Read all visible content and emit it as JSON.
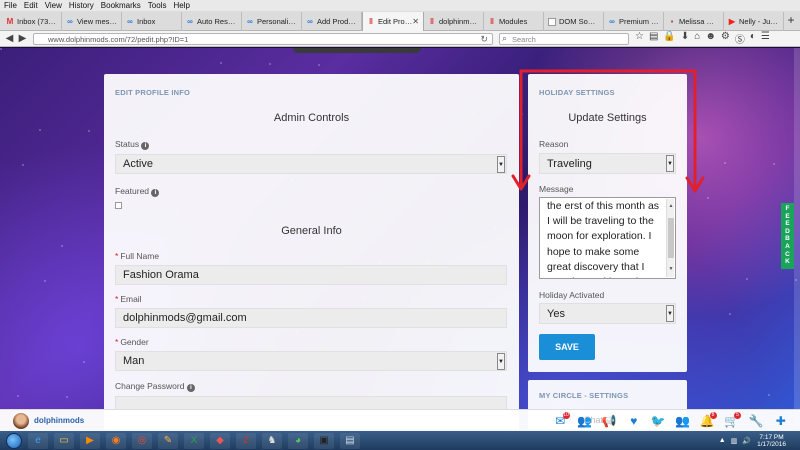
{
  "menubar": [
    "File",
    "Edit",
    "View",
    "History",
    "Bookmarks",
    "Tools",
    "Help"
  ],
  "tabs": [
    {
      "label": "Inbox (737) ...",
      "icon": "gmail-icon",
      "glyph": "M",
      "color": "#d33"
    },
    {
      "label": "View messa...",
      "icon": "link-icon",
      "glyph": "∞",
      "color": "#2f7fd4"
    },
    {
      "label": "Inbox",
      "icon": "link-icon",
      "glyph": "∞",
      "color": "#2f7fd4"
    },
    {
      "label": "Auto Respo...",
      "icon": "link-icon",
      "glyph": "∞",
      "color": "#2f7fd4"
    },
    {
      "label": "Personality ...",
      "icon": "link-icon",
      "glyph": "∞",
      "color": "#2f7fd4"
    },
    {
      "label": "Add Product",
      "icon": "link-icon",
      "glyph": "∞",
      "color": "#2f7fd4"
    },
    {
      "label": "Edit Profi...",
      "icon": "site-icon",
      "glyph": "‖",
      "color": "#d33",
      "active": true
    },
    {
      "label": "dolphinmods",
      "icon": "site-icon",
      "glyph": "‖",
      "color": "#d33"
    },
    {
      "label": "Modules",
      "icon": "site-icon",
      "glyph": "‖",
      "color": "#d33"
    },
    {
      "label": "DOM Source of ...",
      "icon": "page-icon",
      "glyph": "",
      "color": "#888"
    },
    {
      "label": "Premium Fe...",
      "icon": "link-icon",
      "glyph": "∞",
      "color": "#2f7fd4"
    },
    {
      "label": "Melissa Nel...",
      "icon": "image-icon",
      "glyph": "▪",
      "color": "#a55"
    },
    {
      "label": "Nelly - Just ...",
      "icon": "youtube-icon",
      "glyph": "▶",
      "color": "#e22"
    }
  ],
  "url": "www.dolphinmods.com/72/pedit.php?ID=1",
  "search_placeholder": "Search",
  "left_panel": {
    "head": "EDIT PROFILE INFO",
    "admin_title": "Admin Controls",
    "status_label": "Status",
    "status_value": "Active",
    "featured_label": "Featured",
    "general_title": "General Info",
    "fullname_label": "Full Name",
    "fullname_value": "Fashion Orama",
    "email_label": "Email",
    "email_value": "dolphinmods@gmail.com",
    "gender_label": "Gender",
    "gender_value": "Man",
    "password_label": "Change Password"
  },
  "right_panel": {
    "head": "HOLIDAY SETTINGS",
    "title": "Update Settings",
    "reason_label": "Reason",
    "reason_value": "Traveling",
    "message_label": "Message",
    "message_value": "the erst of this month as I will be traveling to the moon for exploration. I hope to make some great discovery that I can share with earth when I return",
    "activated_label": "Holiday Activated",
    "activated_value": "Yes",
    "save_label": "SAVE"
  },
  "circle_panel": {
    "head": "MY CIRCLE - SETTINGS"
  },
  "feedback_label": "FEEDBACK",
  "sitebar": {
    "username": "dolphinmods",
    "ghost_text": "Chat",
    "icons": [
      {
        "name": "mail-icon",
        "glyph": "✉",
        "badge": "10"
      },
      {
        "name": "users-icon",
        "glyph": "👥",
        "badge": ""
      },
      {
        "name": "megaphone-icon",
        "glyph": "📢",
        "badge": ""
      },
      {
        "name": "heart-icon",
        "glyph": "♥",
        "badge": ""
      },
      {
        "name": "twitter-icon",
        "glyph": "🐦",
        "badge": ""
      },
      {
        "name": "group-icon",
        "glyph": "👥",
        "badge": ""
      },
      {
        "name": "bell-icon",
        "glyph": "🔔",
        "badge": "8"
      },
      {
        "name": "cart-icon",
        "glyph": "🛒",
        "badge": "5"
      },
      {
        "name": "wrench-icon",
        "glyph": "🔧",
        "badge": ""
      },
      {
        "name": "plus-icon",
        "glyph": "✚",
        "badge": ""
      }
    ]
  },
  "taskbar": {
    "apps": [
      "ie-icon",
      "folder-icon",
      "media-icon",
      "firefox-icon",
      "chrome-icon",
      "paint-icon",
      "excel-icon",
      "eraser-icon",
      "filezilla-icon",
      "game-icon",
      "frog-icon",
      "terminal-icon",
      "notepad-icon"
    ],
    "time": "7:17 PM",
    "date": "1/17/2016"
  },
  "colors": {
    "accent": "#1a8ed6",
    "annotation": "#e0202c",
    "panel_head": "#7d95b3"
  }
}
